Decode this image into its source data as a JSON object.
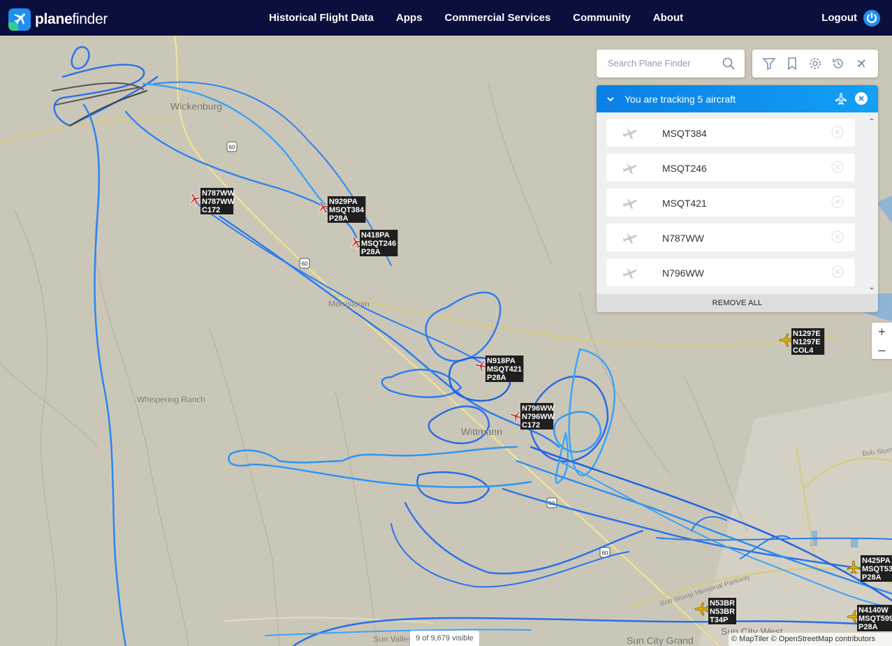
{
  "header": {
    "logo_text_bold": "plane",
    "logo_text": "finder",
    "nav": [
      "Historical Flight Data",
      "Apps",
      "Commercial Services",
      "Community",
      "About"
    ],
    "logout_label": "Logout"
  },
  "search": {
    "placeholder": "Search Plane Finder"
  },
  "tracking": {
    "title": "You are tracking 5 aircraft",
    "items": [
      "MSQT384",
      "MSQT246",
      "MSQT421",
      "N787WW",
      "N796WW"
    ],
    "remove_all": "REMOVE ALL"
  },
  "map": {
    "places": [
      {
        "name": "Wickenburg"
      },
      {
        "name": "Morristown"
      },
      {
        "name": "Whispering Ranch"
      },
      {
        "name": "Wittmann"
      },
      {
        "name": "Sun City West"
      },
      {
        "name": "Sun City Grand"
      },
      {
        "name": "Sun Valley"
      },
      {
        "name": "Bob Stump Memorial Parkway"
      },
      {
        "name": "Bob Stump"
      }
    ],
    "road_shields": [
      "60",
      "60",
      "60",
      "60"
    ],
    "aircraft_labels": [
      [
        "N787WW",
        "N787WW",
        "C172"
      ],
      [
        "N929PA",
        "MSQT384",
        "P28A"
      ],
      [
        "N418PA",
        "MSQT246",
        "P28A"
      ],
      [
        "N918PA",
        "MSQT421",
        "P28A"
      ],
      [
        "N796WW",
        "N796WW",
        "C172"
      ],
      [
        "N1297E",
        "N1297E",
        "COL4"
      ],
      [
        "N425PA",
        "MSQT53",
        "P28A"
      ],
      [
        "N53BR",
        "N53BR",
        "T34P"
      ],
      [
        "N4140W",
        "MSQT599",
        "P28A"
      ]
    ],
    "visible_count": "9 of 9,679 visible",
    "attribution": "© MapTiler © OpenStreetMap contributors",
    "zoom_in": "+",
    "zoom_out": "–"
  },
  "colors": {
    "header_bg": "#0b0f3d",
    "accent": "#1f8ff0",
    "track": "#1e7bef",
    "tracked_plane": "#c0392b",
    "other_plane": "#e8b400"
  }
}
